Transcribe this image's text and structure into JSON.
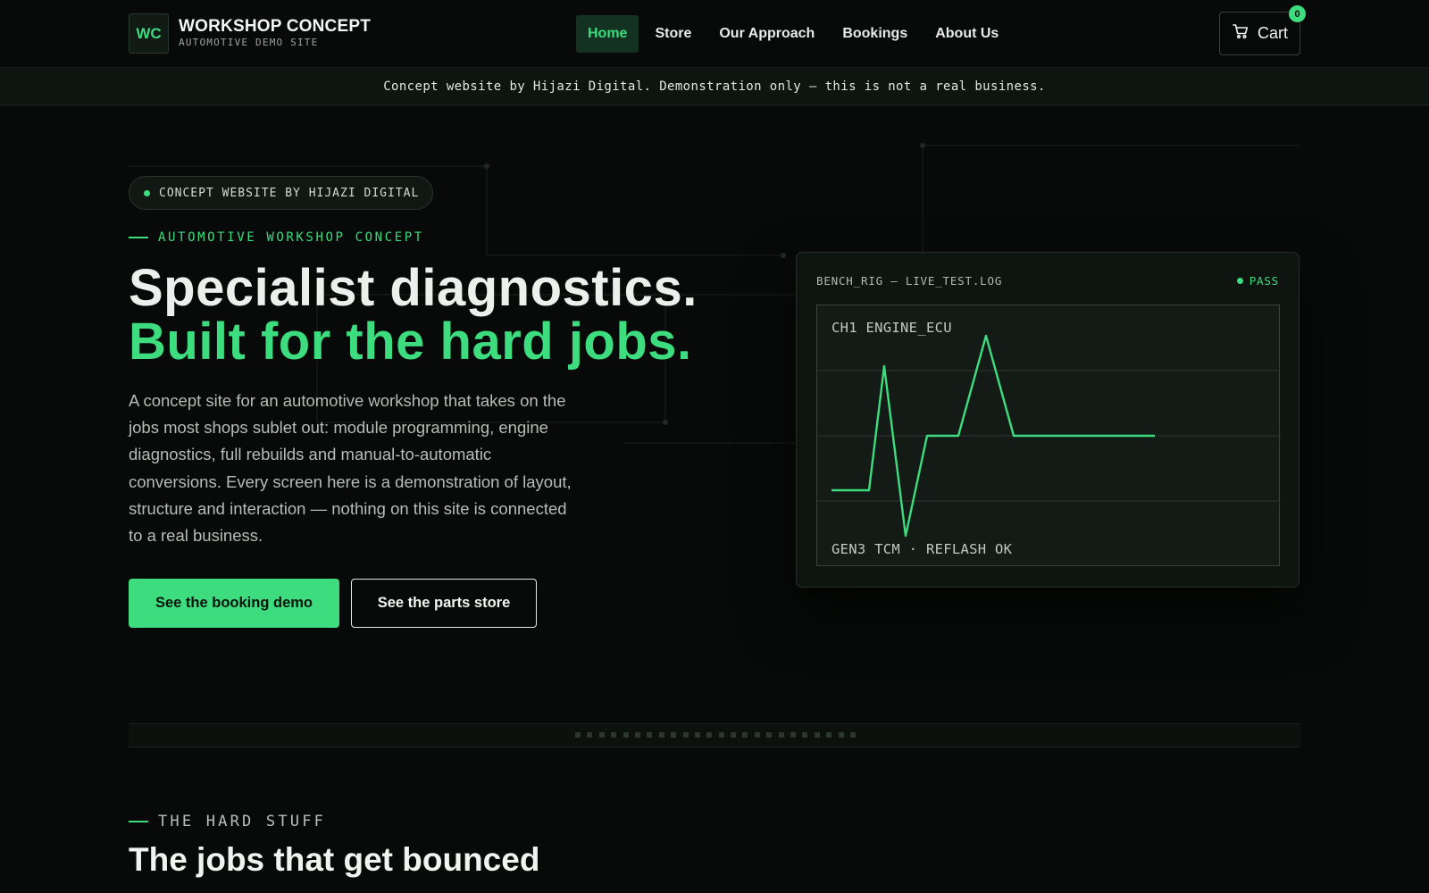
{
  "header": {
    "logo_mark": "WC",
    "brand_name": "WORKSHOP CONCEPT",
    "brand_sub": "AUTOMOTIVE DEMO SITE",
    "nav": [
      {
        "label": "Home",
        "active": true
      },
      {
        "label": "Store",
        "active": false
      },
      {
        "label": "Our Approach",
        "active": false
      },
      {
        "label": "Bookings",
        "active": false
      },
      {
        "label": "About Us",
        "active": false
      }
    ],
    "cart_label": "Cart",
    "cart_count": "0",
    "cart_icon": "cart-icon"
  },
  "notice": "Concept website by Hijazi Digital. Demonstration only — this is not a real business.",
  "hero": {
    "pill": "CONCEPT WEBSITE BY HIJAZI DIGITAL",
    "eyebrow": "AUTOMOTIVE WORKSHOP CONCEPT",
    "headline_line1": "Specialist diagnostics.",
    "headline_line2": "Built for the hard jobs.",
    "lead": "A concept site for an automotive workshop that takes on the jobs most shops sublet out: module programming, engine diagnostics, full rebuilds and manual-to-automatic conversions. Every screen here is a demonstration of layout, structure and interaction — nothing on this site is connected to a real business.",
    "primary_cta": "See the booking demo",
    "secondary_cta": "See the parts store"
  },
  "bench_panel": {
    "title": "BENCH_RIG — LIVE_TEST.LOG",
    "status": "PASS",
    "channel_label": "CH1 ENGINE_ECU",
    "footer_label": "GEN3 TCM · REFLASH OK"
  },
  "section": {
    "eyebrow": "THE HARD STUFF",
    "title": "The jobs that get bounced"
  },
  "colors": {
    "accent": "#3ddc7e",
    "background": "#070a08",
    "panel": "#0e140f"
  }
}
